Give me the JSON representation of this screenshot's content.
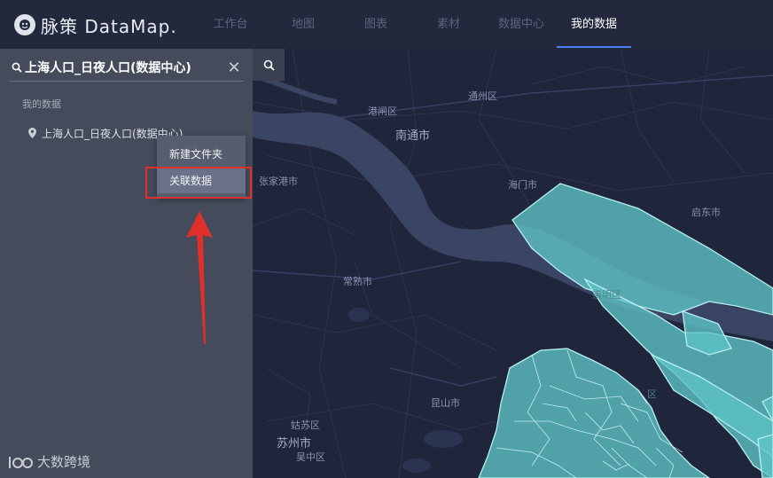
{
  "app": {
    "logo_text": "脉策 DataMap."
  },
  "nav": {
    "tabs": [
      {
        "label": "工作台"
      },
      {
        "label": "地图"
      },
      {
        "label": "图表"
      },
      {
        "label": "素材"
      },
      {
        "label": "数据中心"
      },
      {
        "label": "我的数据"
      }
    ],
    "active_tab": "我的数据"
  },
  "sidebar": {
    "search_value": "上海人口_日夜人口(数据中心)",
    "section_title": "我的数据",
    "items": [
      {
        "label": "上海人口_日夜人口(数据中心)"
      }
    ]
  },
  "context_menu": {
    "items": [
      {
        "label": "新建文件夹"
      },
      {
        "label": "关联数据"
      }
    ],
    "highlighted": "关联数据"
  },
  "map": {
    "labels": [
      {
        "text": "港闸区"
      },
      {
        "text": "通州区"
      },
      {
        "text": "南通市"
      },
      {
        "text": "张家港市"
      },
      {
        "text": "海门市"
      },
      {
        "text": "启东市"
      },
      {
        "text": "崇明区"
      },
      {
        "text": "常熟市"
      },
      {
        "text": "昆山市"
      },
      {
        "text": "姑苏区"
      },
      {
        "text": "苏州市"
      },
      {
        "text": "吴中区"
      },
      {
        "text": "区"
      }
    ],
    "colors": {
      "background": "#1f253b",
      "river": "#3a4563",
      "polygon_fill": "#5fc4c6",
      "polygon_stroke": "#b6f0f0"
    }
  },
  "watermark": {
    "text": "大数跨境"
  },
  "colors": {
    "accent": "#4a7ef0",
    "annotation_red": "#e0302b"
  }
}
